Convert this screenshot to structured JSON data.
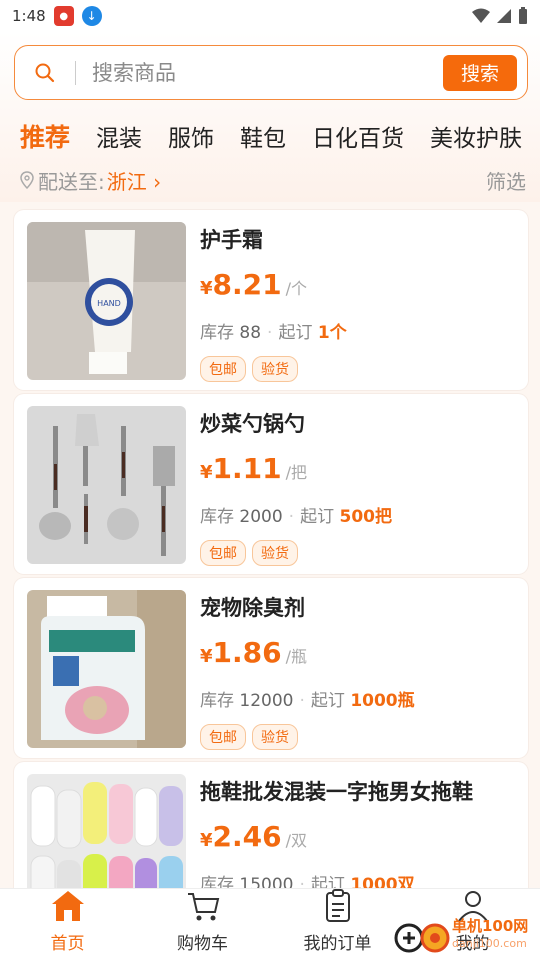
{
  "status_bar": {
    "time": "1:48"
  },
  "search": {
    "placeholder": "搜索商品",
    "button_label": "搜索"
  },
  "tabs": [
    {
      "label": "推荐",
      "active": true
    },
    {
      "label": "混装"
    },
    {
      "label": "服饰"
    },
    {
      "label": "鞋包"
    },
    {
      "label": "日化百货"
    },
    {
      "label": "美妆护肤"
    }
  ],
  "shipping": {
    "label": "配送至:",
    "region": "浙江 ›",
    "filter": "筛选"
  },
  "products": [
    {
      "name": "护手霜",
      "currency": "¥",
      "price": "8.21",
      "unit": "/个",
      "stock_label": "库存",
      "stock": "88",
      "moq_label": "起订",
      "moq": "1个",
      "tags": [
        "包邮",
        "验货"
      ]
    },
    {
      "name": "炒菜勺锅勺",
      "currency": "¥",
      "price": "1.11",
      "unit": "/把",
      "stock_label": "库存",
      "stock": "2000",
      "moq_label": "起订",
      "moq": "500把",
      "tags": [
        "包邮",
        "验货"
      ]
    },
    {
      "name": "宠物除臭剂",
      "currency": "¥",
      "price": "1.86",
      "unit": "/瓶",
      "stock_label": "库存",
      "stock": "12000",
      "moq_label": "起订",
      "moq": "1000瓶",
      "tags": [
        "包邮",
        "验货"
      ]
    },
    {
      "name": "拖鞋批发混装一字拖男女拖鞋",
      "currency": "¥",
      "price": "2.46",
      "unit": "/双",
      "stock_label": "库存",
      "stock": "15000",
      "moq_label": "起订",
      "moq": "1000双",
      "tags": []
    }
  ],
  "bottom_nav": [
    {
      "label": "首页",
      "icon": "home-icon",
      "active": true
    },
    {
      "label": "购物车",
      "icon": "cart-icon"
    },
    {
      "label": "我的订单",
      "icon": "orders-icon"
    },
    {
      "label": "我的",
      "icon": "profile-icon"
    }
  ],
  "watermark": {
    "text": "单机100网",
    "sub": "danji100.com"
  },
  "colors": {
    "accent": "#f26a10",
    "search_button": "#f56a0c",
    "tag_bg": "#fff3e8"
  }
}
